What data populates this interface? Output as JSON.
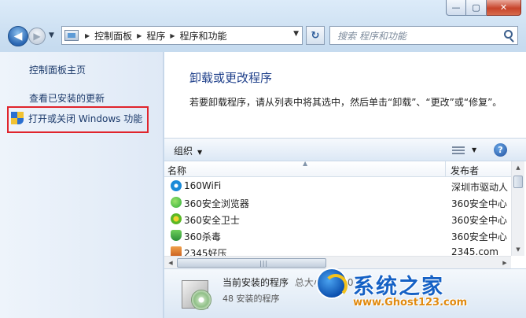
{
  "window": {
    "buttons": {
      "minimize": "—",
      "maximize": "▢",
      "close": "✕"
    }
  },
  "address_bar": {
    "breadcrumbs": [
      "控制面板",
      "程序",
      "程序和功能"
    ]
  },
  "search": {
    "placeholder": "搜索 程序和功能"
  },
  "sidebar": {
    "items": [
      {
        "label": "控制面板主页"
      },
      {
        "label": "查看已安装的更新"
      },
      {
        "label": "打开或关闭 Windows 功能"
      }
    ],
    "highlight_color": "#e0242c"
  },
  "main": {
    "title": "卸载或更改程序",
    "description": "若要卸载程序，请从列表中将其选中，然后单击“卸载”、“更改”或“修复”。"
  },
  "toolbar": {
    "organize_label": "组织"
  },
  "list": {
    "columns": [
      "名称",
      "发布者"
    ],
    "rows": [
      {
        "name": "160WiFi",
        "publisher": "深圳市驱动人",
        "icon": "wifi-icon",
        "color": "#1a8ad8"
      },
      {
        "name": "360安全浏览器",
        "publisher": "360安全中心",
        "icon": "browser-icon",
        "color": "#2fae3b"
      },
      {
        "name": "360安全卫士",
        "publisher": "360安全中心",
        "icon": "guard-icon",
        "color": "#5bb825"
      },
      {
        "name": "360杀毒",
        "publisher": "360安全中心",
        "icon": "antivirus-icon",
        "color": "#3aa54a"
      },
      {
        "name": "2345好压",
        "publisher": "2345.com",
        "icon": "archive-icon",
        "color": "#e0712a"
      }
    ]
  },
  "details": {
    "title": "当前安装的程序",
    "title_overlap": "总大小：1.00 GB",
    "count": "48 安装的程序"
  },
  "watermark": {
    "title": "系统之家",
    "url": "www.Ghost123.com"
  }
}
